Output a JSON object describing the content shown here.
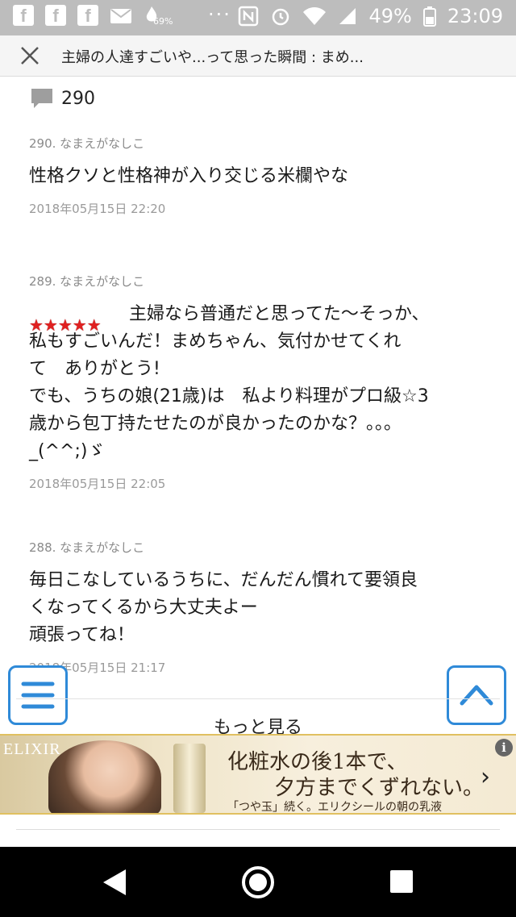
{
  "status_bar": {
    "small_percent": "69%",
    "battery": "49%",
    "time": "23:09",
    "overflow": "···"
  },
  "header": {
    "title": "主婦の人達すごいや...って思った瞬間 : まめ..."
  },
  "comment_count": "290",
  "comments": [
    {
      "head": "290.  なまえがなしこ",
      "body": "性格クソと性格神が入り交じる米欄やな",
      "date": "2018年05月15日 22:20"
    },
    {
      "stars": "★★★★★",
      "head": "289.  なまえがなしこ",
      "body": "主婦なら普通だと思ってた〜そっか、\n私もすごいんだ！まめちゃん、気付かせてくれ\nて　ありがとう!\nでも、うちの娘(21歳)は　私より料理がプロ級☆3\n歳から包丁持たせたのが良かったのかな？。。。\n_(^^;)ゞ",
      "date": "2018年05月15日 22:05"
    },
    {
      "head": "288.  なまえがなしこ",
      "body": "毎日こなしているうちに、だんだん慣れて要領良\nくなってくるから大丈夫よー\n頑張ってね！",
      "date": "2018年05月15日 21:17"
    }
  ],
  "more_label": "もっと見る",
  "ad": {
    "brand": "ELIXIR",
    "line1": "化粧水の後1本で、",
    "line2": "夕方までくずれない。",
    "line3": "「つや玉」続く。エリクシールの朝の乳液",
    "info": "i",
    "arrow": "›"
  }
}
